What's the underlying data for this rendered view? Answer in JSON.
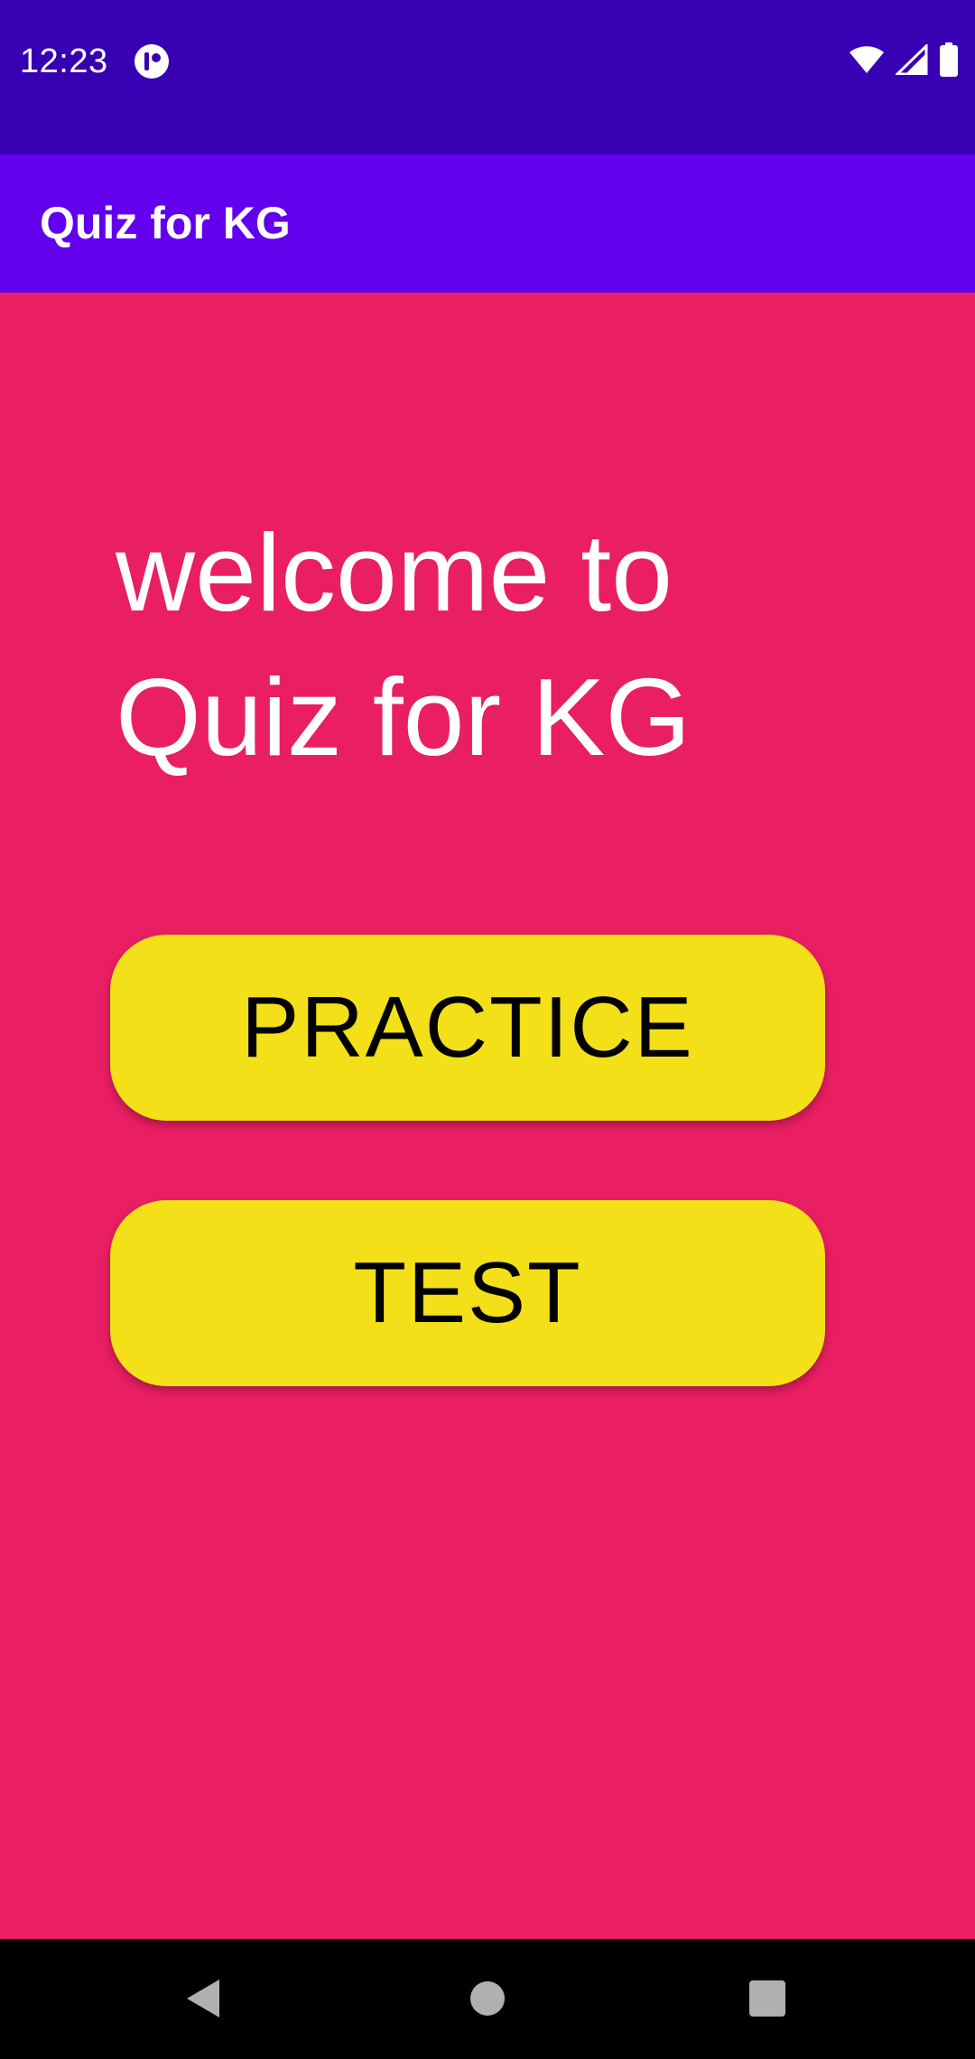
{
  "status_bar": {
    "time": "12:23",
    "icons": [
      "notification-app-icon",
      "wifi-icon",
      "signal-icon",
      "battery-icon"
    ]
  },
  "app_bar": {
    "title": "Quiz for KG"
  },
  "main": {
    "welcome_text": "welcome to\nQuiz for KG",
    "practice_label": "PRACTICE",
    "test_label": "TEST"
  },
  "nav_bar": {
    "icons": [
      "back-icon",
      "home-icon",
      "recents-icon"
    ]
  },
  "colors": {
    "status_bar": "#3700B3",
    "app_bar": "#6200EE",
    "background": "#E91E63",
    "button": "#F3E018",
    "button_text": "#000000",
    "nav_bar": "#000000"
  }
}
